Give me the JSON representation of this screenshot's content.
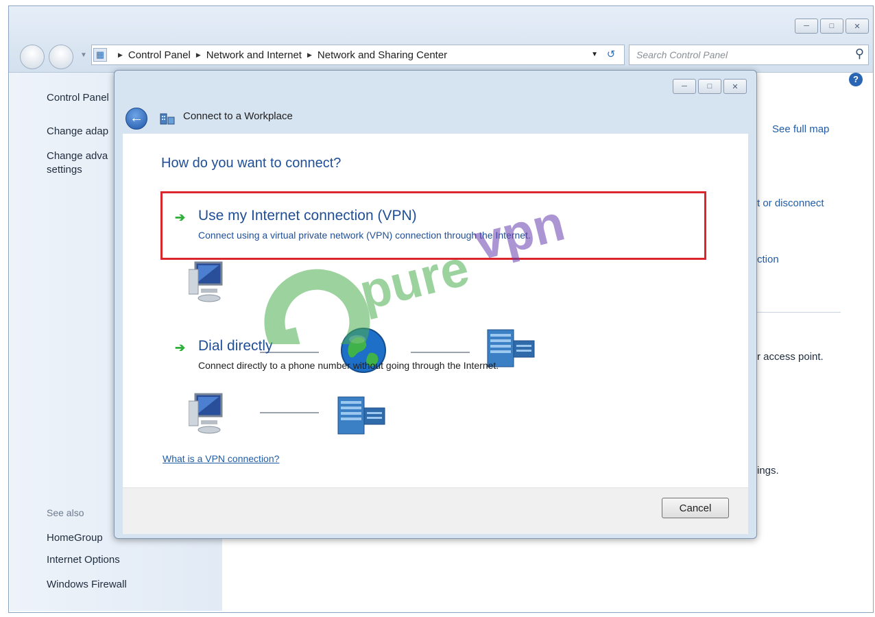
{
  "explorer": {
    "window_buttons": [
      "minimize",
      "maximize",
      "close"
    ],
    "breadcrumbs": [
      "Control Panel",
      "Network and Internet",
      "Network and Sharing Center"
    ],
    "search_placeholder": "Search Control Panel"
  },
  "left_pane": {
    "items": [
      "Control Panel",
      "Change adap",
      "Change adva",
      "settings"
    ],
    "see_also_label": "See also",
    "see_also": [
      "HomeGroup",
      "Internet Options",
      "Windows Firewall"
    ]
  },
  "right_pane": {
    "see_full_map": "See full map",
    "fragments": [
      "t or disconnect",
      "ction",
      "r access point.",
      "ings."
    ]
  },
  "dialog": {
    "title": "Connect to a Workplace",
    "heading": "How do you want to connect?",
    "option_vpn": {
      "title": "Use my Internet connection (VPN)",
      "description": "Connect using a virtual private network (VPN) connection through the Internet."
    },
    "option_dial": {
      "title": "Dial directly",
      "description": "Connect directly to a phone number without going through the Internet."
    },
    "help_link": "What is a VPN connection?",
    "cancel_label": "Cancel"
  },
  "watermark": {
    "text_green": "pure",
    "text_purple": "vpn",
    "color_green": "#4caf50",
    "color_purple": "#6a3fb0"
  },
  "colors": {
    "heading_blue": "#1f4e96",
    "link_blue": "#1f5ca8",
    "highlight_red": "#d9262c",
    "arrow_green": "#2fae3a"
  },
  "icons": [
    "search-icon",
    "refresh-icon",
    "back-arrow-icon",
    "help-icon",
    "computer-icon",
    "globe-icon",
    "server-icon",
    "network-icon"
  ]
}
